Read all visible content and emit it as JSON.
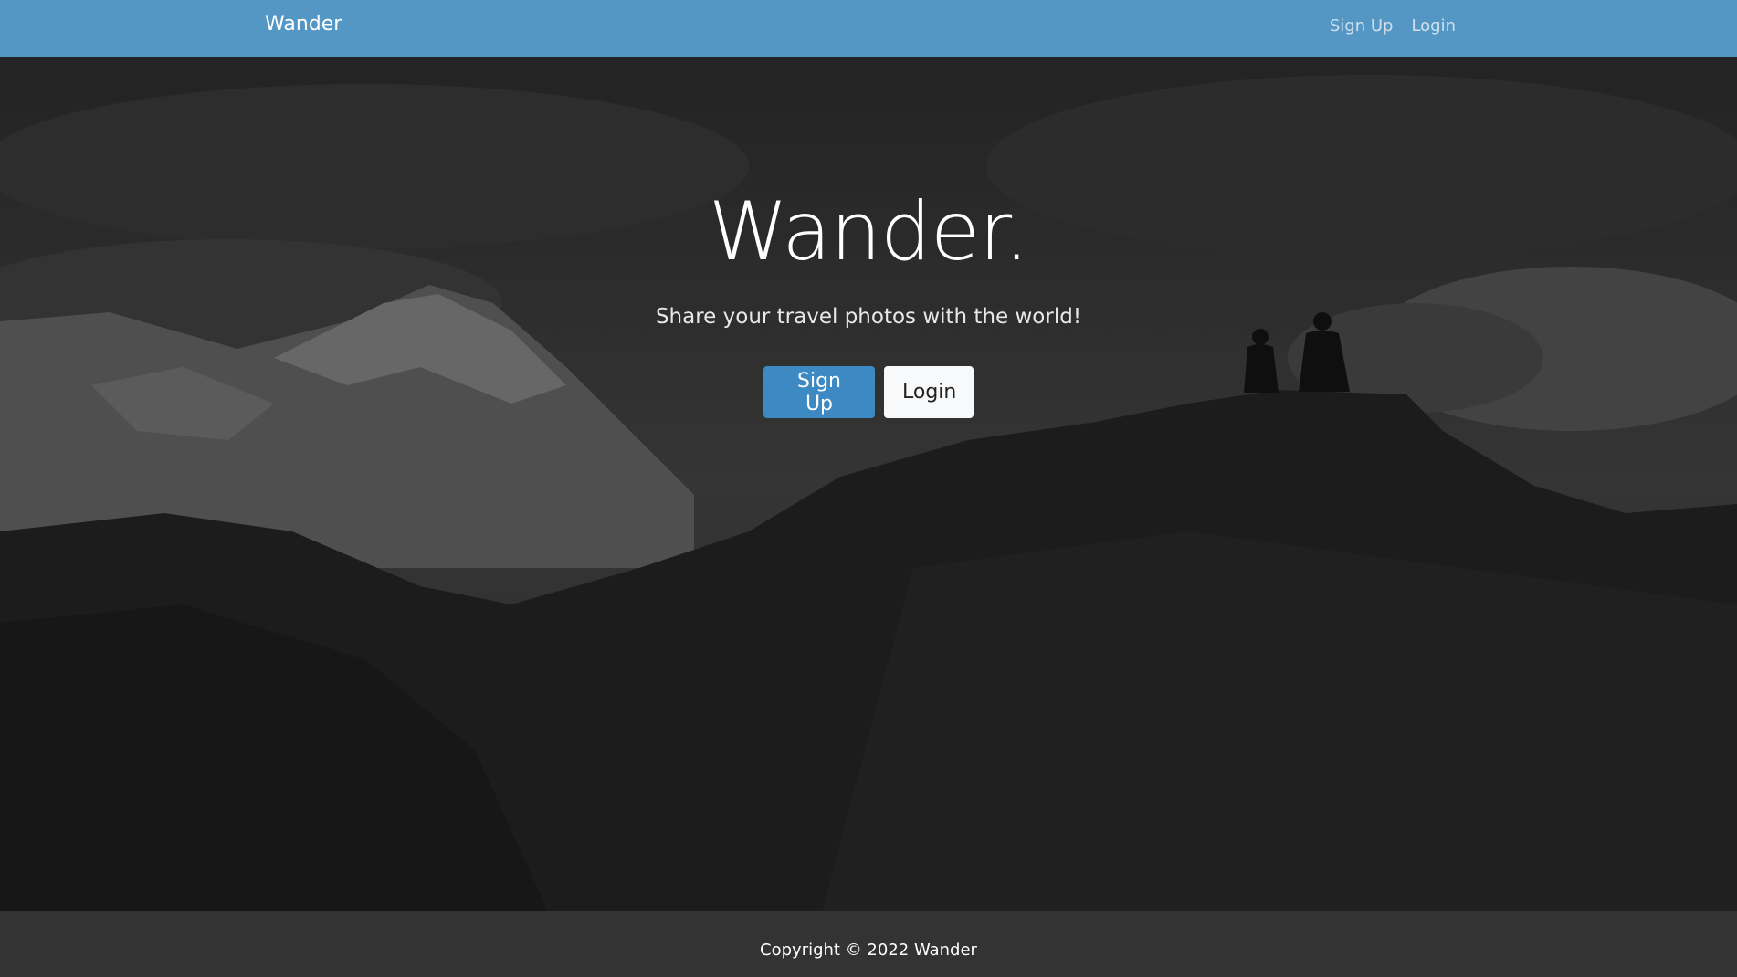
{
  "navbar": {
    "brand": "Wander",
    "links": [
      "Sign Up",
      "Login"
    ]
  },
  "hero": {
    "title": "Wander.",
    "subtitle": "Share your travel photos with the world!",
    "buttons": {
      "signup": "Sign Up",
      "login": "Login"
    }
  },
  "footer": {
    "copyright": "Copyright © 2022 Wander"
  },
  "colors": {
    "navbar": "#5597c4",
    "primary_button": "#3c89c3",
    "footer": "#333333"
  }
}
